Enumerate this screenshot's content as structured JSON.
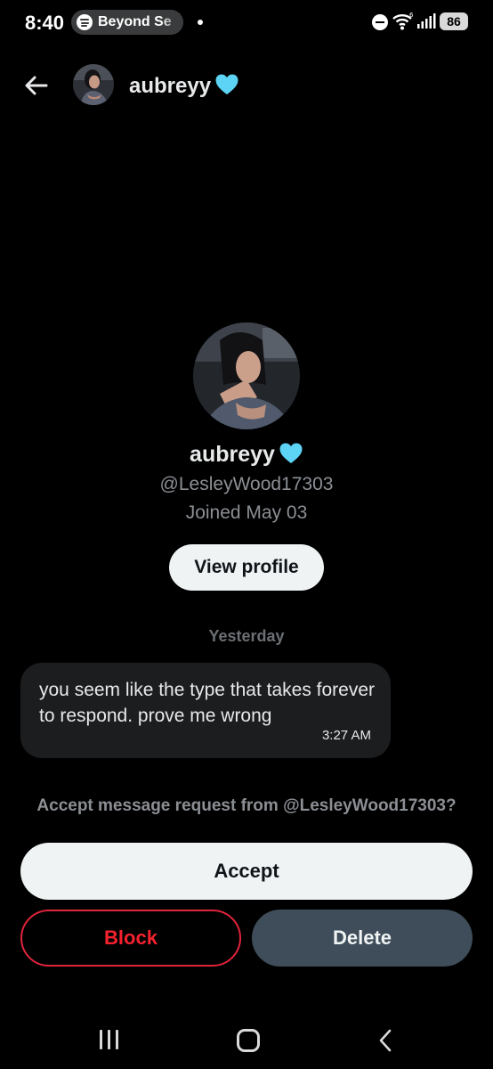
{
  "status_bar": {
    "time": "8:40",
    "media_label": "Beyond Se",
    "battery": "86",
    "icons": [
      "spotify-icon",
      "dnd-icon",
      "wifi-icon",
      "signal-icon",
      "battery-icon"
    ]
  },
  "header": {
    "name": "aubreyy",
    "verified_emoji": "light-blue-heart-icon"
  },
  "profile": {
    "name": "aubreyy",
    "handle": "@LesleyWood17303",
    "joined": "Joined May 03",
    "view_profile_label": "View profile"
  },
  "conversation": {
    "date_divider": "Yesterday",
    "messages": [
      {
        "text": "you seem like the type that takes forever to respond. prove me wrong",
        "time": "3:27 AM"
      }
    ]
  },
  "request": {
    "prompt": "Accept message request from @LesleyWood17303?",
    "accept_label": "Accept",
    "block_label": "Block",
    "delete_label": "Delete"
  },
  "colors": {
    "background": "#000000",
    "block_red": "#f4212e",
    "delete_bg": "#3e4d59",
    "heart": "#5dd4f5",
    "muted_text": "#8b8f94"
  }
}
